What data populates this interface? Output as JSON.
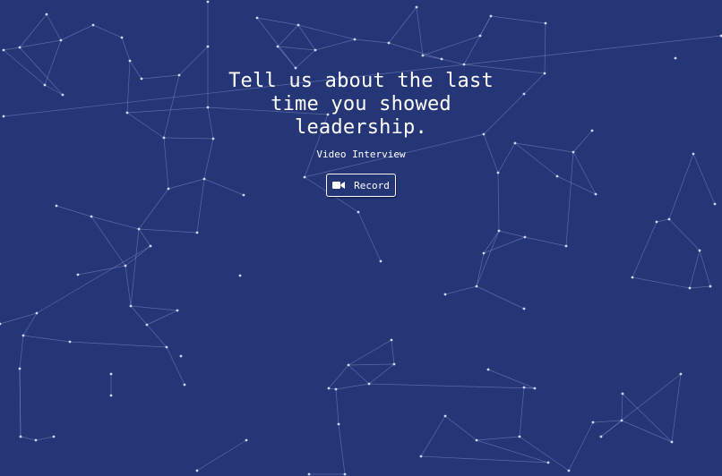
{
  "prompt": {
    "question": "Tell us about the last time you showed leadership.",
    "subtitle": "Video Interview"
  },
  "actions": {
    "record_label": "Record",
    "record_icon": "video-camera-icon"
  },
  "theme": {
    "background": "#243676",
    "text": "#ffffff",
    "network_line": "#7f8fc4",
    "network_node": "#c8d2f2"
  }
}
